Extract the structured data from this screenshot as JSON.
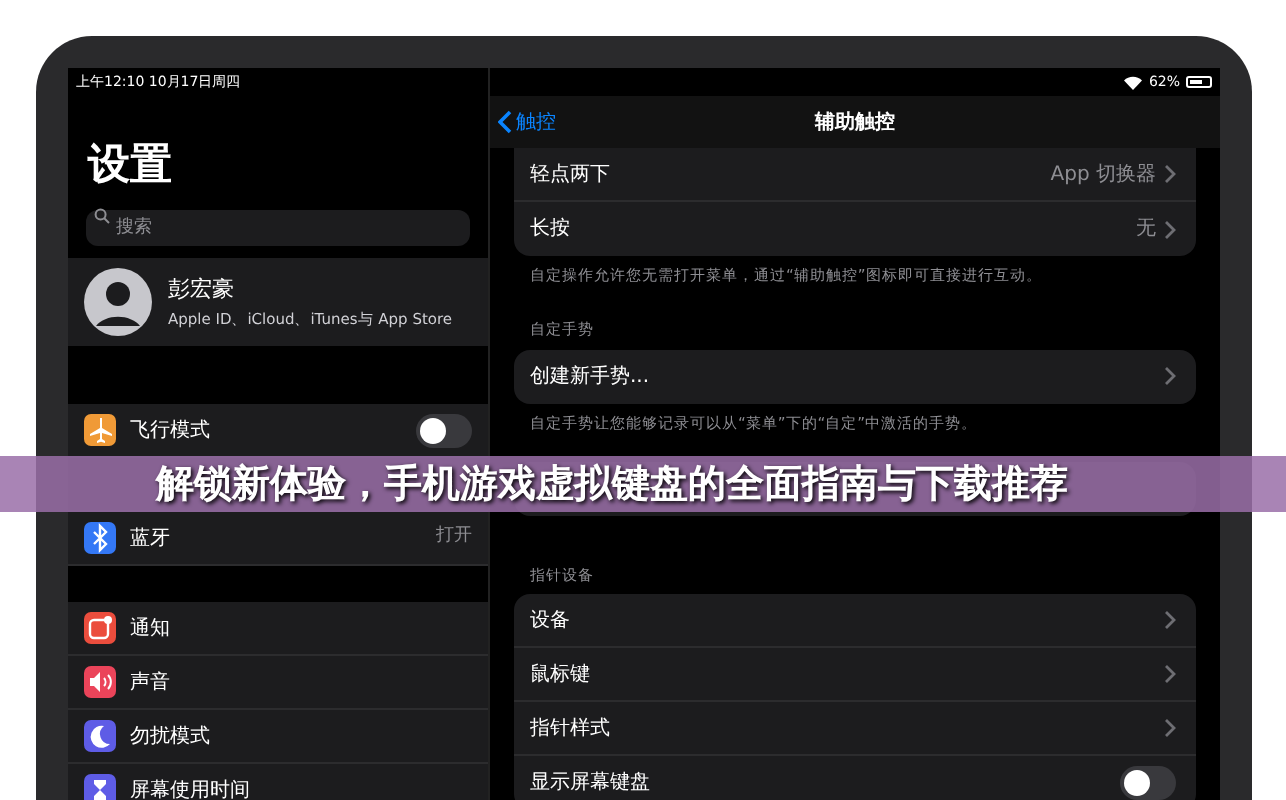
{
  "status_bar": {
    "time_date": "上午12:10  10月17日周四",
    "battery": "62%"
  },
  "sidebar": {
    "title": "设置",
    "search": {
      "placeholder": "搜索"
    },
    "profile": {
      "name": "彭宏豪",
      "subtitle": "Apple ID、iCloud、iTunes与 App Store"
    },
    "groups": [
      [
        {
          "kind": "toggle",
          "label": "飞行模式",
          "color": "#f09a37",
          "on": false
        },
        {
          "kind": "blank"
        },
        {
          "kind": "value",
          "label": "蓝牙",
          "value": "打开",
          "color": "#3478f6"
        }
      ],
      [
        {
          "kind": "plain",
          "label": "通知",
          "color": "#eb4d3d"
        },
        {
          "kind": "plain",
          "label": "声音",
          "color": "#eb445a"
        },
        {
          "kind": "plain",
          "label": "勿扰模式",
          "color": "#5e5ce6"
        },
        {
          "kind": "plain",
          "label": "屏幕使用时间",
          "color": "#5e5ce6"
        }
      ]
    ]
  },
  "detail": {
    "back": "触控",
    "title": "辅助触控",
    "sections": [
      {
        "rows": [
          {
            "kind": "value",
            "label": "轻点两下",
            "value": "App 切换器"
          },
          {
            "kind": "value",
            "label": "长按",
            "value": "无"
          }
        ],
        "footer": "自定操作允许您无需打开菜单，通过“辅助触控”图标即可直接进行互动。"
      },
      {
        "header": "自定手势",
        "rows": [
          {
            "kind": "nav",
            "label": "创建新手势..."
          }
        ],
        "footer": "自定手势让您能够记录可以从“菜单”下的“自定”中激活的手势。"
      },
      {
        "rows": [
          {
            "kind": "blank"
          }
        ]
      },
      {
        "header": "指针设备",
        "rows": [
          {
            "kind": "nav",
            "label": "设备"
          },
          {
            "kind": "nav",
            "label": "鼠标键"
          },
          {
            "kind": "nav",
            "label": "指针样式"
          },
          {
            "kind": "toggle",
            "label": "显示屏幕键盘",
            "on": false
          }
        ]
      }
    ]
  },
  "banner": {
    "title": "解锁新体验，手机游戏虚拟键盘的全面指南与下载推荐"
  }
}
